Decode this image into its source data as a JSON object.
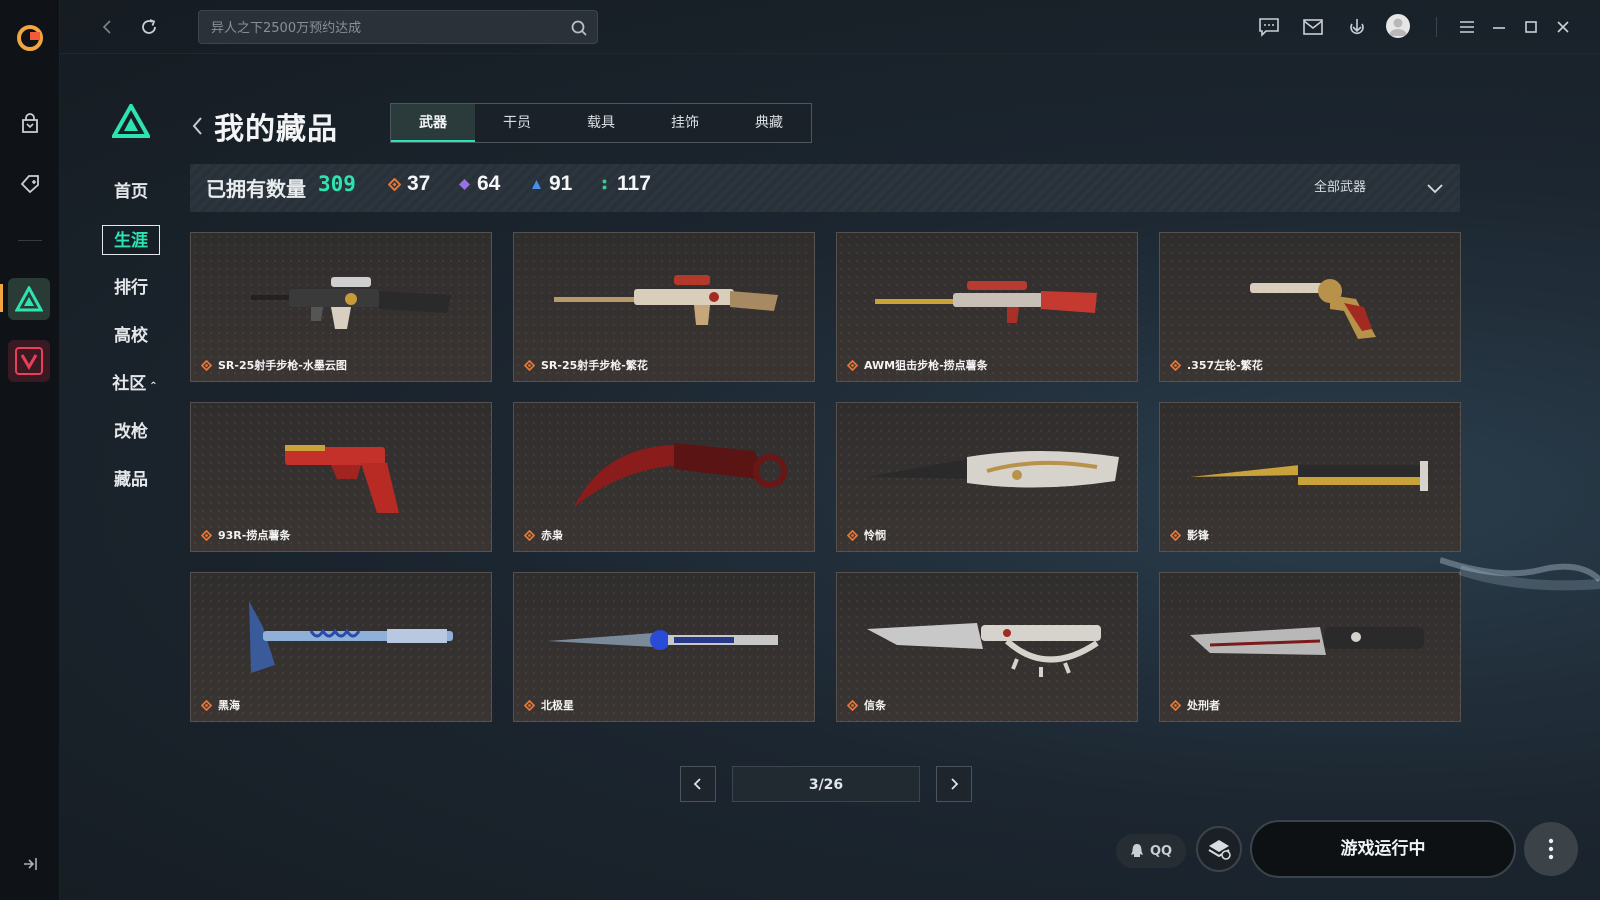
{
  "search": {
    "placeholder": "异人之下2500万预约达成"
  },
  "nav": {
    "items": [
      {
        "label": "首页"
      },
      {
        "label": "生涯"
      },
      {
        "label": "排行"
      },
      {
        "label": "高校"
      },
      {
        "label": "社区"
      },
      {
        "label": "改枪"
      },
      {
        "label": "藏品"
      }
    ],
    "active": "生涯"
  },
  "header": {
    "title": "我的藏品",
    "tabs": [
      {
        "label": "武器"
      },
      {
        "label": "干员"
      },
      {
        "label": "载具"
      },
      {
        "label": "挂饰"
      },
      {
        "label": "典藏"
      }
    ],
    "active_tab": "武器"
  },
  "stats": {
    "owned_label": "已拥有数量",
    "owned_total": "309",
    "counts": [
      {
        "value": "37",
        "color": "#e0773a",
        "icon": "orange-gem-icon"
      },
      {
        "value": "64",
        "color": "#9a6ee8",
        "icon": "purple-gem-icon"
      },
      {
        "value": "91",
        "color": "#4a8ee8",
        "icon": "blue-gem-icon"
      },
      {
        "value": "117",
        "color": "#39c98f",
        "icon": "green-gem-icon"
      }
    ],
    "filter_label": "全部武器"
  },
  "items": [
    {
      "name": "SR-25射手步枪-水墨云图",
      "rarity_color": "#e0773a"
    },
    {
      "name": "SR-25射手步枪-繁花",
      "rarity_color": "#e0773a"
    },
    {
      "name": "AWM狙击步枪-捞点薯条",
      "rarity_color": "#e0773a"
    },
    {
      "name": ".357左轮-繁花",
      "rarity_color": "#e0773a"
    },
    {
      "name": "93R-捞点薯条",
      "rarity_color": "#e0773a"
    },
    {
      "name": "赤枭",
      "rarity_color": "#e0773a"
    },
    {
      "name": "怜悯",
      "rarity_color": "#e0773a"
    },
    {
      "name": "影锋",
      "rarity_color": "#e0773a"
    },
    {
      "name": "黑海",
      "rarity_color": "#e0773a"
    },
    {
      "name": "北极星",
      "rarity_color": "#e0773a"
    },
    {
      "name": "信条",
      "rarity_color": "#e0773a"
    },
    {
      "name": "处刑者",
      "rarity_color": "#e0773a"
    }
  ],
  "pagination": {
    "label": "3/26"
  },
  "bottom": {
    "qq_label": "QQ",
    "status_button": "游戏运行中"
  },
  "colors": {
    "accent": "#2de3b0",
    "rarity_orange": "#e0773a"
  }
}
